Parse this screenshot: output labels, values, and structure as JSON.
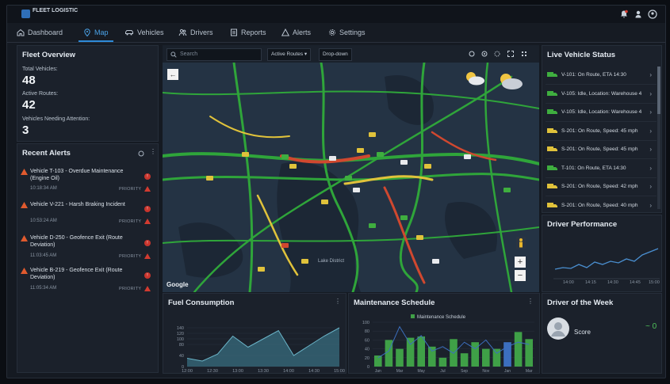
{
  "app": {
    "logo_text": "FLEET LOGISTIC",
    "notifications_label": "Notifications",
    "settings_label": "Settings",
    "account_label": "Account"
  },
  "nav": {
    "items": [
      {
        "label": "Dashboard",
        "icon": "home-icon"
      },
      {
        "label": "Map",
        "icon": "map-pin-icon",
        "active": true
      },
      {
        "label": "Vehicles",
        "icon": "car-icon"
      },
      {
        "label": "Drivers",
        "icon": "users-icon"
      },
      {
        "label": "Reports",
        "icon": "report-icon"
      },
      {
        "label": "Alerts",
        "icon": "alert-icon"
      },
      {
        "label": "Settings",
        "icon": "gear-icon"
      }
    ]
  },
  "fleet_overview": {
    "title": "Fleet Overview",
    "total_label": "Total Vehicles:",
    "total_value": "48",
    "active_label": "Active Routes:",
    "active_value": "42",
    "attention_label": "Vehicles Needing Attention:",
    "attention_value": "3"
  },
  "recent_alerts": {
    "title": "Recent Alerts",
    "items": [
      {
        "text": "Vehicle T-103 - Overdue Maintenance (Engine Oil)",
        "time": "10:18:34 AM",
        "priority": "PRIORITY",
        "badge": "!"
      },
      {
        "text": "Vehicle V-221 - Harsh Braking Incident",
        "time": "10:53:24 AM",
        "priority": "PRIORITY",
        "badge": "!"
      },
      {
        "text": "Vehicle D-250 - Geofence Exit (Route Deviation)",
        "time": "11:03:45 AM",
        "priority": "PRIORITY",
        "badge": "!"
      },
      {
        "text": "Vehicle B-219 - Geofence Exit (Route Deviation)",
        "time": "11:05:34 AM",
        "priority": "PRIORITY",
        "badge": "!"
      }
    ]
  },
  "map": {
    "search_placeholder": "Search",
    "filter_label": "Active Routes ▾",
    "filter2_label": "Drop-down",
    "attribution": "Google",
    "zoom_in": "+",
    "zoom_out": "−",
    "city_label": "Lake District",
    "colors": {
      "water": "#1e2b3a",
      "land": "#243344",
      "fast": "#2fa53a",
      "medium": "#e0c23b",
      "slow": "#d0482f"
    }
  },
  "live_status": {
    "title": "Live Vehicle Status",
    "items": [
      {
        "text": "V-101: On Route, ETA 14:30",
        "color": "#3fae3f"
      },
      {
        "text": "V-105: Idle, Location: Warehouse 4",
        "color": "#3fae3f"
      },
      {
        "text": "V-105: Idle, Location: Warehouse 4",
        "color": "#3fae3f"
      },
      {
        "text": "S-201: On Route, Speed: 45 mph",
        "color": "#e0c23b"
      },
      {
        "text": "S-201: On Route, Speed: 45 mph",
        "color": "#e0c23b"
      },
      {
        "text": "T-101: On Route, ETA 14:30",
        "color": "#3fae3f"
      },
      {
        "text": "S-201: On Route, Speed: 42 mph",
        "color": "#e0c23b"
      },
      {
        "text": "S-201: On Route, Speed: 40 mph",
        "color": "#e0c23b"
      }
    ]
  },
  "driver_performance": {
    "title": "Driver Performance",
    "x_labels": [
      "14:00",
      "14:15",
      "14:30",
      "14:45",
      "15:00"
    ]
  },
  "fuel": {
    "title": "Fuel Consumption",
    "chart_data": {
      "type": "area",
      "x": [
        "12:00",
        "12:30",
        "13:00",
        "13:30",
        "14:00",
        "14:30",
        "15:00"
      ],
      "values": [
        30,
        20,
        45,
        110,
        70,
        100,
        130,
        40,
        75,
        110,
        140
      ],
      "ylim": [
        0,
        160
      ],
      "yticks": [
        0,
        40,
        80,
        100,
        120,
        140
      ],
      "series_color": "#3f7f93"
    }
  },
  "maintenance": {
    "title": "Maintenance Schedule",
    "legend": "Maintenance Schedule",
    "chart_data": {
      "type": "bar",
      "categories": [
        "Jan",
        "Feb",
        "Mar",
        "Apr",
        "May",
        "Jun",
        "Jul",
        "Aug",
        "Sep",
        "Oct",
        "Nov",
        "Dec",
        "Jan",
        "Feb",
        "Mar"
      ],
      "values": [
        25,
        60,
        40,
        65,
        68,
        45,
        20,
        62,
        30,
        55,
        40,
        40,
        55,
        78,
        62
      ],
      "line": [
        20,
        35,
        90,
        50,
        70,
        35,
        45,
        30,
        55,
        40,
        60,
        30,
        45,
        55,
        50
      ],
      "ylim": [
        0,
        100
      ],
      "yticks": [
        0,
        20,
        40,
        60,
        80,
        100
      ]
    }
  },
  "driver_week": {
    "title": "Driver of the Week",
    "score_label": "Score",
    "score_value": "0"
  }
}
